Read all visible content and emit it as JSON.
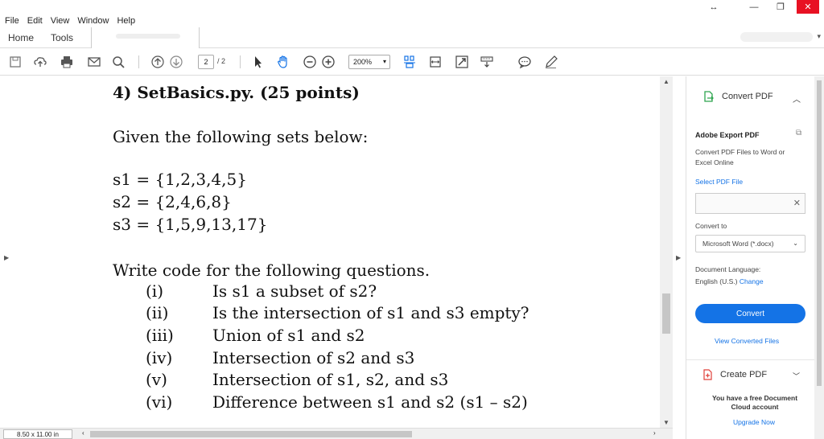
{
  "window": {
    "minimize": "—",
    "maximize": "❐",
    "close": "✕",
    "resize": "↔"
  },
  "menu": [
    "File",
    "Edit",
    "View",
    "Window",
    "Help"
  ],
  "tabs": {
    "home": "Home",
    "tools": "Tools"
  },
  "toolbar": {
    "page_current": "2",
    "page_total": "/ 2",
    "zoom": "200%"
  },
  "document": {
    "heading": "4) SetBasics.py. (25 points)",
    "given": "Given the following sets below:",
    "sets": [
      "s1 = {1,2,3,4,5}",
      "s2 = {2,4,6,8}",
      "s3 = {1,5,9,13,17}"
    ],
    "intro": "Write code for the following questions.",
    "questions": [
      {
        "num": "(i)",
        "text": "Is s1 a subset of s2?"
      },
      {
        "num": "(ii)",
        "text": "Is the intersection of s1 and s3 empty?"
      },
      {
        "num": "(iii)",
        "text": "Union of s1 and s2"
      },
      {
        "num": "(iv)",
        "text": "Intersection of s2 and s3"
      },
      {
        "num": "(v)",
        "text": "Intersection of s1, s2, and s3"
      },
      {
        "num": "(vi)",
        "text": "Difference between s1 and s2 (s1 – s2)"
      }
    ]
  },
  "status": {
    "page_size": "8.50 x 11.00 in"
  },
  "pane": {
    "convert_title": "Convert PDF",
    "export_title": "Adobe Export PDF",
    "export_desc": "Convert PDF Files to Word or Excel Online",
    "select_file": "Select PDF File",
    "convert_to": "Convert to",
    "format": "Microsoft Word (*.docx)",
    "doc_language_label": "Document Language:",
    "doc_language": "English (U.S.)",
    "change": "Change",
    "convert_button": "Convert",
    "view_converted": "View Converted Files",
    "create_pdf": "Create PDF",
    "free_account": "You have a free Document Cloud account",
    "upgrade": "Upgrade Now"
  }
}
